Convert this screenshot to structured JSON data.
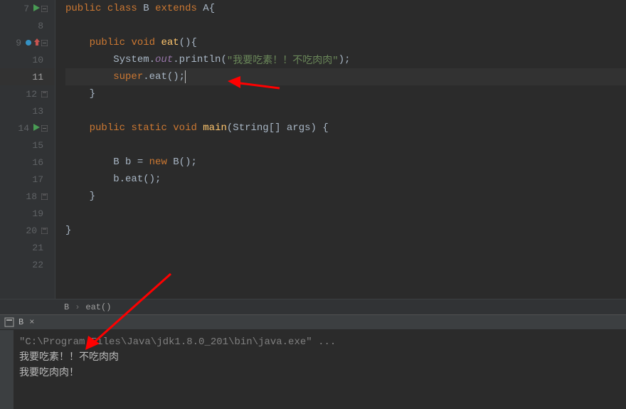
{
  "gutter": {
    "lines": [
      "7",
      "8",
      "9",
      "10",
      "11",
      "12",
      "13",
      "14",
      "15",
      "16",
      "17",
      "18",
      "19",
      "20",
      "21",
      "22"
    ]
  },
  "code": {
    "l7": {
      "kw_public": "public",
      "kw_class": "class",
      "name": "B",
      "kw_extends": "extends",
      "super": "A",
      "brace": "{"
    },
    "l9": {
      "kw_public": "public",
      "kw_void": "void",
      "method": "eat",
      "rest": "(){"
    },
    "l10": {
      "before": "System.",
      "field": "out",
      "after": ".println(",
      "string": "\"我要吃素！！不吃肉肉\"",
      "end": ");"
    },
    "l11": {
      "kw_super": "super",
      "after": ".eat();"
    },
    "l12": {
      "brace": "}"
    },
    "l14": {
      "kw_public": "public",
      "kw_static": "static",
      "kw_void": "void",
      "method": "main",
      "args_pre": "(String[] ",
      "args": "args",
      "args_post": ") {"
    },
    "l16": {
      "pre": "B b = ",
      "kw_new": "new",
      "after": " B();"
    },
    "l17": {
      "text": "b.eat();"
    },
    "l18": {
      "brace": "}"
    },
    "l20": {
      "brace": "}"
    }
  },
  "breadcrumb": {
    "class": "B",
    "method": "eat()"
  },
  "runTab": {
    "label": "B"
  },
  "console": {
    "cmd": "\"C:\\Program Files\\Java\\jdk1.8.0_201\\bin\\java.exe\" ...",
    "out1": "我要吃素！！不吃肉肉",
    "out2": "我要吃肉肉！"
  }
}
